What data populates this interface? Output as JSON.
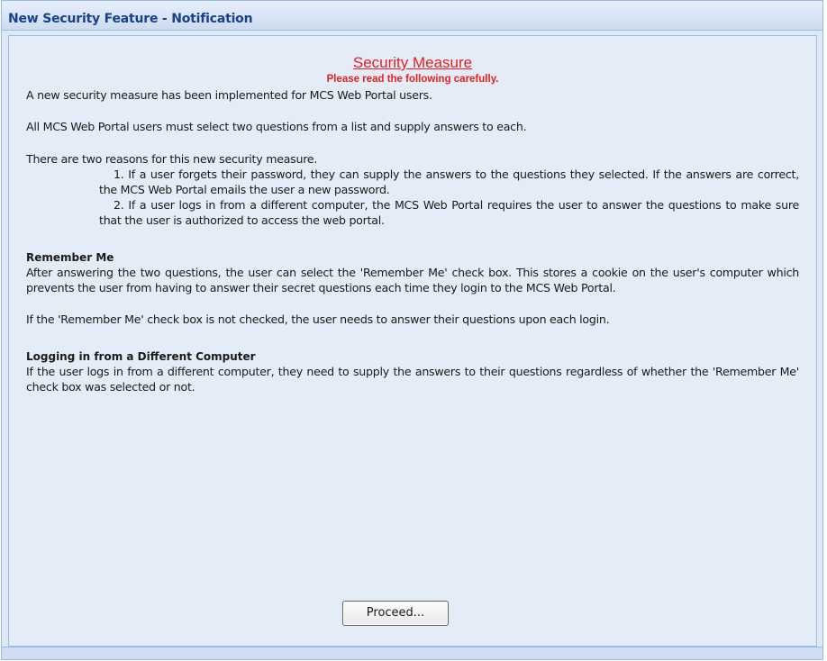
{
  "window": {
    "title": "New Security Feature - Notification"
  },
  "content": {
    "heading": "Security Measure",
    "subheading": "Please read the following carefully.",
    "intro1": "A new security measure has been implemented for MCS Web Portal users.",
    "intro2": "All MCS Web Portal users must select two questions from a list and supply answers to each.",
    "reasons_intro": "There are two reasons for this new security measure.",
    "reason1": "1. If a user forgets their password, they can supply the answers to the questions they selected. If the answers are correct, the MCS Web Portal emails the user a new password.",
    "reason2": "2. If a user logs in from a different computer, the MCS Web Portal requires the user to answer the questions to make sure that the user is authorized to access the web portal.",
    "remember_title": "Remember Me",
    "remember_text": "After answering the two questions, the user can select the 'Remember Me' check box. This stores a cookie on the user's computer which prevents the user from having to answer their secret questions each time they login to the MCS Web Portal.",
    "remember_text2": "If the 'Remember Me' check box is not checked, the user needs to answer their questions upon each login.",
    "different_title": "Logging in from a Different Computer",
    "different_text": "If the user logs in from a different computer, they need to supply the answers to their questions regardless of whether the 'Remember Me' check box was selected or not."
  },
  "actions": {
    "proceed_label": "Proceed..."
  },
  "colors": {
    "title_text": "#15428b",
    "heading_red": "#e81f1f",
    "panel_bg": "#e4ecf7",
    "border": "#99bbe8"
  }
}
